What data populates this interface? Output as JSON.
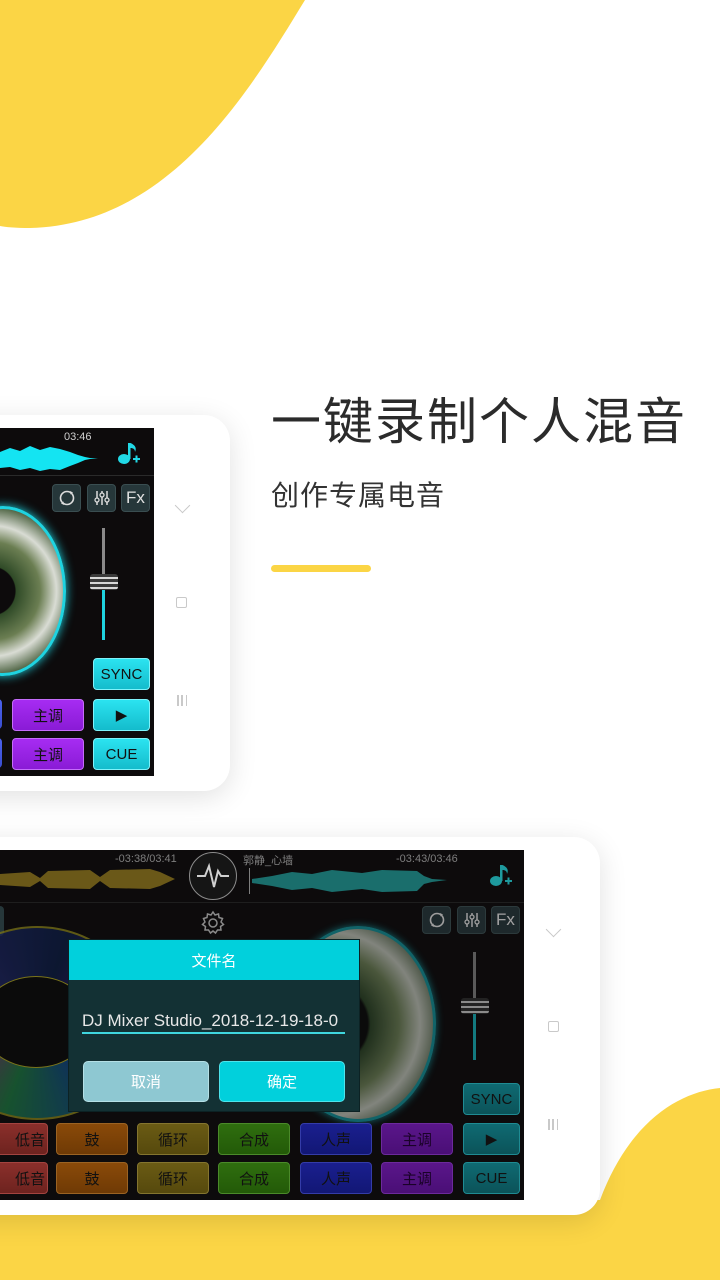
{
  "colors": {
    "accent_yellow": "#fbd545",
    "dialog_header": "#01d0dc",
    "pad_cyan": "#14bccc",
    "pad_purple": "#8a1bd6"
  },
  "promo": {
    "headline": "一键录制个人混音",
    "subline": "创作专属电音"
  },
  "phone_top": {
    "time_right": "03:46",
    "icons": [
      "loop-icon",
      "equalizer-icon",
      "fx-icon"
    ],
    "fx_label": "Fx",
    "sync_label": "SYNC",
    "play_label": "▶",
    "cue_label": "CUE",
    "pads_row1": [
      "主调"
    ],
    "pads_row2": [
      "主调"
    ],
    "crossfader_level": 0.6
  },
  "phone_bottom": {
    "left_deck_time": "-03:38/03:41",
    "right_deck_track": "郭静_心墙",
    "right_deck_time": "-03:43/03:46",
    "fx_label": "Fx",
    "sync_label": "SYNC",
    "play_label": "▶",
    "cue_label": "CUE",
    "pads_row1": [
      "低音",
      "鼓",
      "循环",
      "合成",
      "人声",
      "主调"
    ],
    "pads_row2": [
      "低音",
      "鼓",
      "循环",
      "合成",
      "人声",
      "主调"
    ],
    "crossfader_level": 0.5,
    "dialog": {
      "title": "文件名",
      "filename_value": "DJ Mixer Studio_2018-12-19-18-0",
      "cancel_label": "取消",
      "ok_label": "确定"
    }
  }
}
